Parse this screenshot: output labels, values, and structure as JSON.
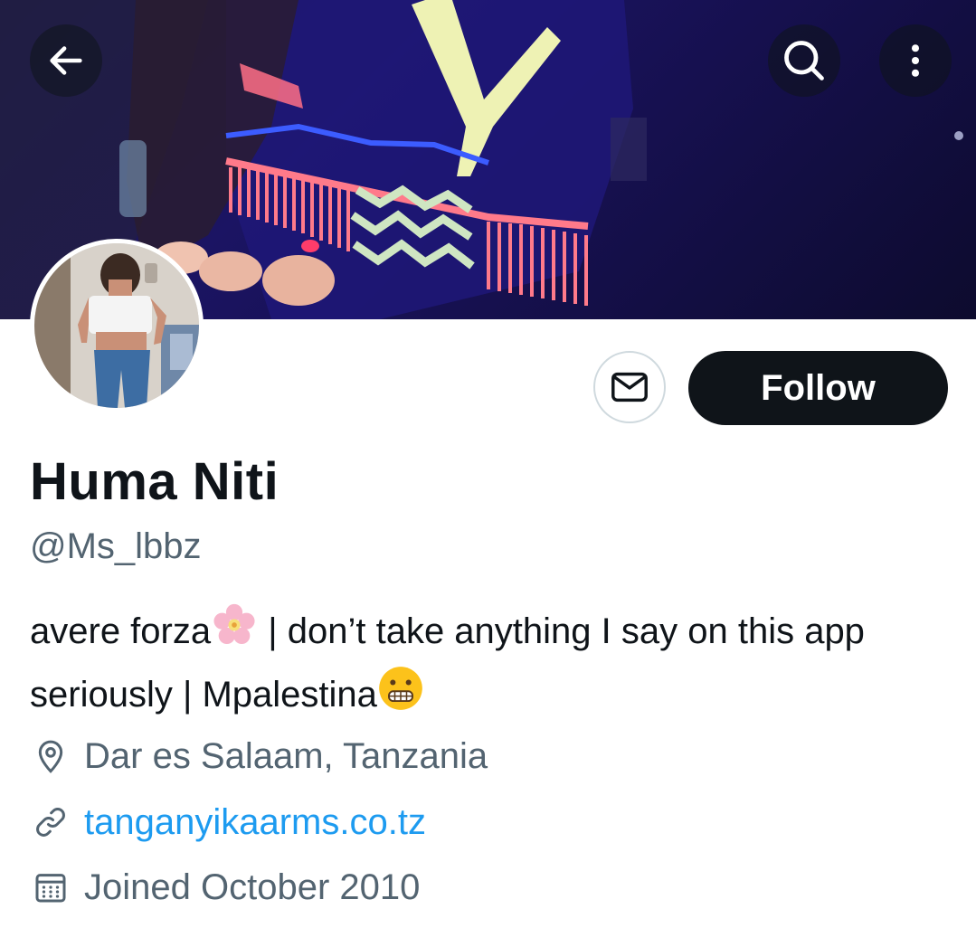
{
  "header": {
    "back_icon": "arrow-left-icon",
    "search_icon": "search-icon",
    "more_icon": "more-vertical-icon"
  },
  "profile": {
    "name": "Huma Niti",
    "handle": "@Ms_lbbz",
    "bio_part1": "avere forza",
    "bio_emoji1": "cherry-blossom-icon",
    "bio_part2": " | don’t take anything I say on this app seriously | Mpalestina",
    "bio_emoji2": "grimacing-face-icon",
    "location": "Dar es Salaam, Tanzania",
    "website": "tanganyikaarms.co.tz",
    "joined": "Joined October 2010"
  },
  "actions": {
    "follow_label": "Follow",
    "message_icon": "mail-icon"
  },
  "colors": {
    "follow_bg": "#0f1419",
    "link": "#1d9bf0",
    "secondary_text": "#536471"
  }
}
